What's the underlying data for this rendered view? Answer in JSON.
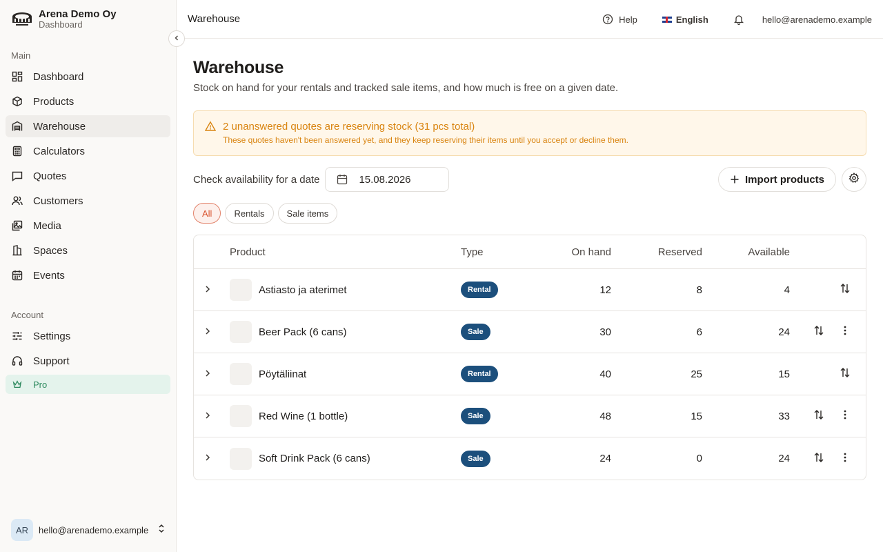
{
  "brand": {
    "name": "Arena Demo Oy",
    "subtitle": "Dashboard",
    "logo_icon": "stadium-icon"
  },
  "sidebar": {
    "main_label": "Main",
    "main_items": [
      {
        "label": "Dashboard",
        "icon": "dashboard-icon"
      },
      {
        "label": "Products",
        "icon": "box-icon"
      },
      {
        "label": "Warehouse",
        "icon": "warehouse-icon",
        "active": true
      },
      {
        "label": "Calculators",
        "icon": "calculator-icon"
      },
      {
        "label": "Quotes",
        "icon": "message-icon"
      },
      {
        "label": "Customers",
        "icon": "users-icon"
      },
      {
        "label": "Media",
        "icon": "images-icon"
      },
      {
        "label": "Spaces",
        "icon": "building-icon"
      },
      {
        "label": "Events",
        "icon": "calendar-icon"
      }
    ],
    "account_label": "Account",
    "account_items": [
      {
        "label": "Settings",
        "icon": "sliders-icon"
      },
      {
        "label": "Support",
        "icon": "headphones-icon"
      },
      {
        "label": "Pro",
        "icon": "crown-icon"
      }
    ],
    "user": {
      "initials": "AR",
      "email": "hello@arenademo.example"
    }
  },
  "topbar": {
    "title": "Warehouse",
    "help": "Help",
    "language": "English",
    "email": "hello@arenademo.example"
  },
  "page": {
    "title": "Warehouse",
    "subtitle": "Stock on hand for your rentals and tracked sale items, and how much is free on a given date."
  },
  "alert": {
    "title": "2 unanswered quotes are reserving stock (31 pcs total)",
    "description": "These quotes haven't been answered yet, and they keep reserving their items until you accept or decline them.",
    "color": "#d98410"
  },
  "toolbar": {
    "date_label": "Check availability for a date",
    "date_value": "15.08.2026",
    "import_label": "Import products"
  },
  "filters": [
    {
      "label": "All",
      "active": true
    },
    {
      "label": "Rentals"
    },
    {
      "label": "Sale items"
    }
  ],
  "table": {
    "headers": {
      "product": "Product",
      "type": "Type",
      "on_hand": "On hand",
      "reserved": "Reserved",
      "available": "Available"
    },
    "rows": [
      {
        "name": "Astiasto ja aterimet",
        "type": "Rental",
        "on_hand": "12",
        "reserved": "8",
        "available": "4",
        "has_menu": false
      },
      {
        "name": "Beer Pack (6 cans)",
        "type": "Sale",
        "on_hand": "30",
        "reserved": "6",
        "available": "24",
        "has_menu": true
      },
      {
        "name": "Pöytäliinat",
        "type": "Rental",
        "on_hand": "40",
        "reserved": "25",
        "available": "15",
        "has_menu": false
      },
      {
        "name": "Red Wine (1 bottle)",
        "type": "Sale",
        "on_hand": "48",
        "reserved": "15",
        "available": "33",
        "has_menu": true
      },
      {
        "name": "Soft Drink Pack (6 cans)",
        "type": "Sale",
        "on_hand": "24",
        "reserved": "0",
        "available": "24",
        "has_menu": true
      }
    ]
  },
  "colors": {
    "accent": "#d9532f",
    "badge": "#1c4f7c",
    "pro": "#2e8a5f"
  }
}
